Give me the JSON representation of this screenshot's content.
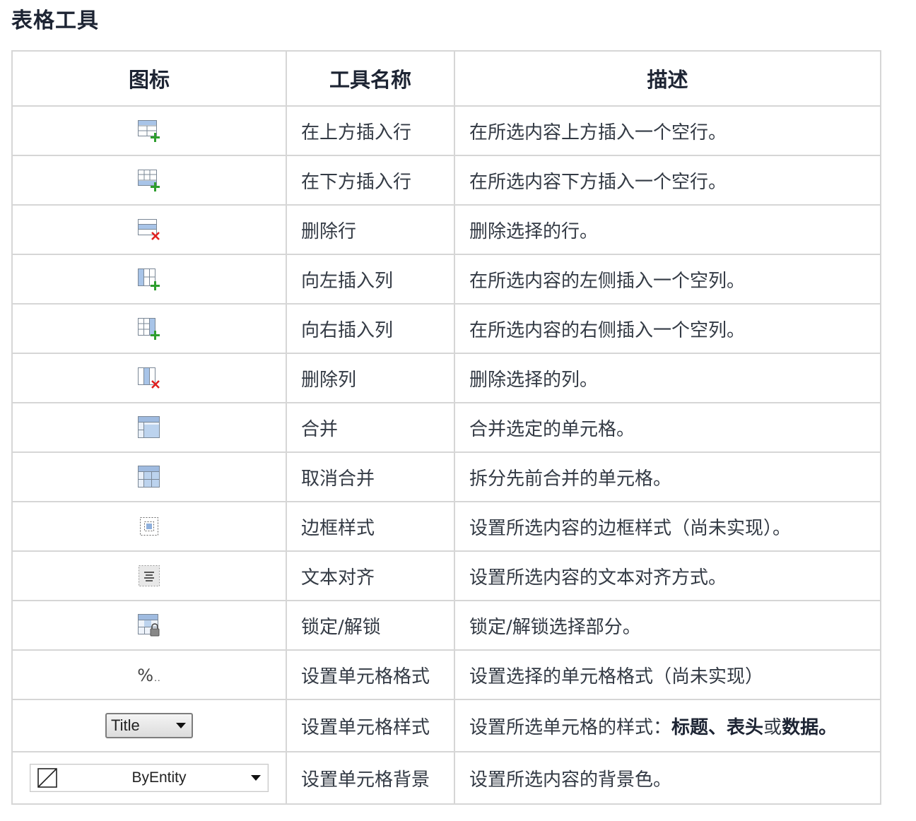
{
  "page": {
    "title": "表格工具"
  },
  "table": {
    "headers": {
      "icon": "图标",
      "name": "工具名称",
      "description": "描述"
    },
    "rows": [
      {
        "icon": "insert-row-above-icon",
        "name": "在上方插入行",
        "description": "在所选内容上方插入一个空行。"
      },
      {
        "icon": "insert-row-below-icon",
        "name": "在下方插入行",
        "description": "在所选内容下方插入一个空行。"
      },
      {
        "icon": "delete-row-icon",
        "name": "删除行",
        "description": "删除选择的行。"
      },
      {
        "icon": "insert-column-left-icon",
        "name": "向左插入列",
        "description": "在所选内容的左侧插入一个空列。"
      },
      {
        "icon": "insert-column-right-icon",
        "name": "向右插入列",
        "description": "在所选内容的右侧插入一个空列。"
      },
      {
        "icon": "delete-column-icon",
        "name": "删除列",
        "description": "删除选择的列。"
      },
      {
        "icon": "merge-cells-icon",
        "name": "合并",
        "description": "合并选定的单元格。"
      },
      {
        "icon": "unmerge-cells-icon",
        "name": "取消合并",
        "description": "拆分先前合并的单元格。"
      },
      {
        "icon": "border-style-icon",
        "name": "边框样式",
        "description": "设置所选内容的边框样式（尚未实现）。"
      },
      {
        "icon": "text-align-icon",
        "name": "文本对齐",
        "description": "设置所选内容的文本对齐方式。"
      },
      {
        "icon": "lock-unlock-icon",
        "name": "锁定/解锁",
        "description": "锁定/解锁选择部分。"
      },
      {
        "icon": "percent-format-icon",
        "icon_text": "%",
        "icon_text_small": "..",
        "name": "设置单元格格式",
        "description": "设置选择的单元格格式（尚未实现）"
      },
      {
        "icon": "title-dropdown",
        "dropdown_value": "Title",
        "name": "设置单元格样式",
        "description_parts": [
          "设置所选单元格的样式：",
          "标题",
          "、",
          "表头",
          "或",
          "数据",
          "。"
        ]
      },
      {
        "icon": "byentity-dropdown",
        "dropdown_value": "ByEntity",
        "name": "设置单元格背景",
        "description": "设置所选内容的背景色。"
      }
    ]
  },
  "colors": {
    "plus": "#2e9e2e",
    "cross": "#e02020",
    "header_text": "#1d2433",
    "border": "#d6d6d6",
    "cell_blue": "#bcd3ee"
  }
}
